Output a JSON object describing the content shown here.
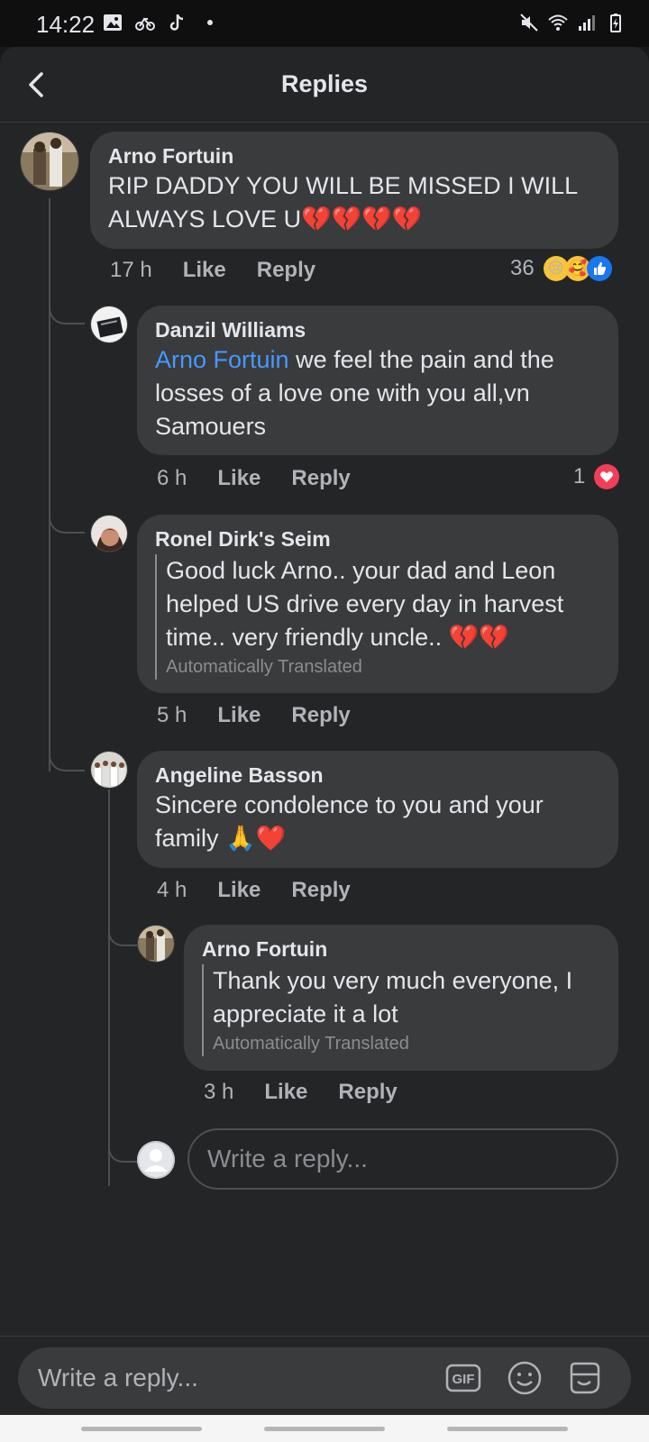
{
  "status_bar": {
    "time": "14:22"
  },
  "header": {
    "title": "Replies"
  },
  "comments": [
    {
      "author": "Arno Fortuin",
      "text": "RIP DADDY YOU WILL BE MISSED I WILL ALWAYS LOVE U",
      "emoji": "💔💔💔💔",
      "time": "17 h",
      "like_label": "Like",
      "reply_label": "Reply",
      "reaction_count": "36"
    },
    {
      "author": "Danzil Williams",
      "mention": "Arno Fortuin",
      "text": " we feel the pain and the losses of a love one with you all,vn Samouers",
      "time": "6 h",
      "like_label": "Like",
      "reply_label": "Reply",
      "reaction_count": "1"
    },
    {
      "author": "Ronel Dirk's Seim",
      "text": "Good luck Arno.. your dad and Leon helped US drive every day in harvest time.. very friendly uncle.. ",
      "emoji": "💔💔",
      "translated_note": "Automatically Translated",
      "time": "5 h",
      "like_label": "Like",
      "reply_label": "Reply"
    },
    {
      "author": "Angeline Basson",
      "text": "Sincere condolence to you and your family ",
      "emoji": "🙏❤️",
      "time": "4 h",
      "like_label": "Like",
      "reply_label": "Reply"
    },
    {
      "author": "Arno Fortuin",
      "text": "Thank you very much everyone, I appreciate it a lot",
      "translated_note": "Automatically Translated",
      "time": "3 h",
      "like_label": "Like",
      "reply_label": "Reply"
    }
  ],
  "nested_reply_input": {
    "placeholder": "Write a reply..."
  },
  "bottom_composer": {
    "placeholder": "Write a reply...",
    "gif_label": "GIF"
  },
  "colors": {
    "background": "#242526",
    "bubble": "#3a3b3c",
    "mention": "#4599ff",
    "like_reaction": "#1877f2",
    "love_reaction": "#f33e58"
  }
}
